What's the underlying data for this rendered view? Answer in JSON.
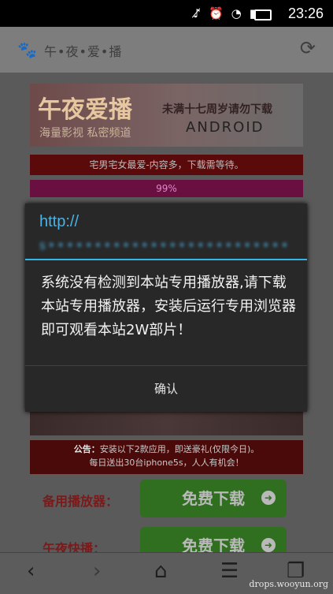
{
  "status_bar": {
    "icons": [
      "mute-icon",
      "alarm-icon",
      "wifi-icon",
      "signal-icon",
      "battery-icon"
    ],
    "time": "23:26"
  },
  "browser": {
    "site_title": "午•夜•爱•播"
  },
  "page": {
    "banner": {
      "title": "午夜爱播",
      "subtitle": "海量影视 私密频道",
      "age_notice": "未满十七周岁请勿下载",
      "platform": "ANDROID"
    },
    "strip_text": "宅男宅女最爱-内容多，下载需等待。",
    "progress_label": "99%",
    "notice_label": "公告：",
    "notice_line1": "安装以下2款应用，即送豪礼(仅限今日)。",
    "notice_line2": "每日送出30台iphone5s，人人有机会！",
    "downloads": [
      {
        "label": "备用播放器：",
        "button": "免费下载"
      },
      {
        "label": "午夜快播：",
        "button": "免费下载"
      }
    ]
  },
  "dialog": {
    "title": "http://",
    "url_blurred": "s•••••••••••••••••••••••••••20•••.com",
    "message": "系统没有检测到本站专用播放器,请下载本站专用播放器，安装后运行专用浏览器即可观看本站2W部片！",
    "confirm": "确认"
  },
  "navbar": {
    "back": "‹",
    "forward": "›"
  },
  "watermark": "drops.wooyun.org"
}
